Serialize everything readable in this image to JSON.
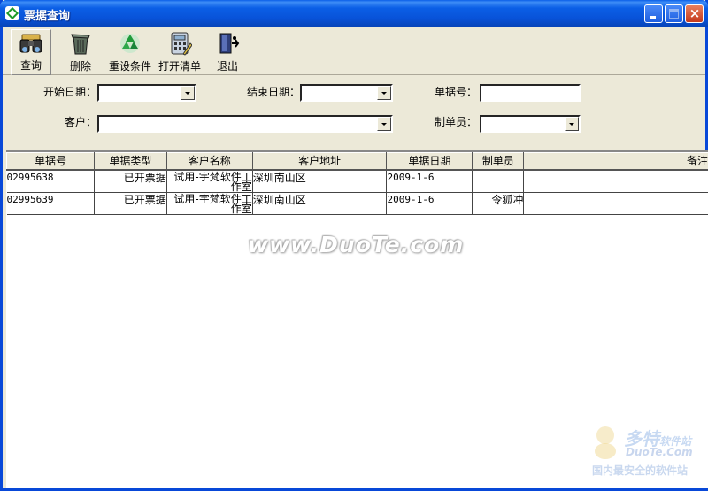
{
  "window": {
    "title": "票据查询"
  },
  "toolbar": {
    "items": [
      {
        "label": "查询",
        "icon": "binoculars-icon"
      },
      {
        "label": "删除",
        "icon": "trash-icon"
      },
      {
        "label": "重设条件",
        "icon": "recycle-icon"
      },
      {
        "label": "打开清单",
        "icon": "calculator-icon"
      },
      {
        "label": "退出",
        "icon": "exit-door-icon"
      }
    ]
  },
  "form": {
    "start_date_label": "开始日期：",
    "end_date_label": "结束日期：",
    "doc_no_label": "单据号：",
    "customer_label": "客户：",
    "creator_label": "制单员：",
    "start_date_value": "",
    "end_date_value": "",
    "doc_no_value": "",
    "customer_value": "",
    "creator_value": ""
  },
  "table": {
    "columns": [
      "单据号",
      "单据类型",
      "客户名称",
      "客户地址",
      "单据日期",
      "制单员",
      "备注"
    ],
    "rows": [
      [
        "02995638",
        "已开票据",
        "试用-宇梵软件工作室",
        "深圳南山区",
        "2009-1-6",
        "",
        ""
      ],
      [
        "02995639",
        "已开票据",
        "试用-宇梵软件工作室",
        "深圳南山区",
        "2009-1-6",
        "令狐冲",
        ""
      ]
    ]
  },
  "watermark": {
    "main": "www.DuoTe.com",
    "brand": "多特",
    "brand_suffix": "软件站",
    "url": "DuoTe.Com",
    "slogan": "国内最安全的软件站"
  }
}
